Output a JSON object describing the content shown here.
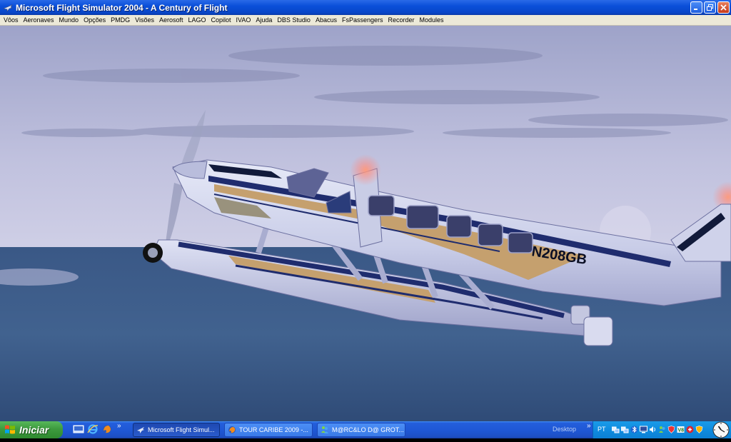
{
  "window": {
    "title": "Microsoft Flight Simulator 2004 - A Century of Flight",
    "app_icon": "plane-icon",
    "controls": [
      "minimize",
      "maximize",
      "close"
    ]
  },
  "menu": [
    "Vôos",
    "Aeronaves",
    "Mundo",
    "Opções",
    "PMDG",
    "Visões",
    "Aerosoft",
    "LAGO",
    "Copilot",
    "IVAO",
    "Ajuda",
    "DBS Studio",
    "Abacus",
    "FsPassengers",
    "Recorder",
    "Modules"
  ],
  "scene": {
    "registration": "N208GB",
    "colors": {
      "sky_top": "#9ea3c9",
      "sky_bottom": "#c9c9e3",
      "sea": "#3a5a86",
      "fuselage": "#d9ddf1",
      "stripe_navy": "#1f2c6e",
      "stripe_gold": "#c5a06e"
    }
  },
  "taskbar": {
    "start_label": "Iniciar",
    "quick_launch": [
      "show-desktop-icon",
      "internet-explorer-icon",
      "firefox-icon"
    ],
    "tasks": [
      {
        "label": "Microsoft Flight Simul...",
        "icon": "plane-icon",
        "active": true
      },
      {
        "label": "TOUR CARIBE 2009 -...",
        "icon": "firefox-icon",
        "active": false
      },
      {
        "label": "M@RC&LO D@ GROT...",
        "icon": "messenger-icon",
        "active": false
      }
    ],
    "desktop_label": "Desktop",
    "language": "PT",
    "tray_icons": [
      "network-icon",
      "network-icon",
      "bluetooth-icon",
      "monitor-icon",
      "volume-icon",
      "messenger-icon",
      "shield-icon",
      "vlc-icon",
      "antivirus-icon",
      "security-icon"
    ],
    "clock_icon": "analog-clock-icon"
  }
}
